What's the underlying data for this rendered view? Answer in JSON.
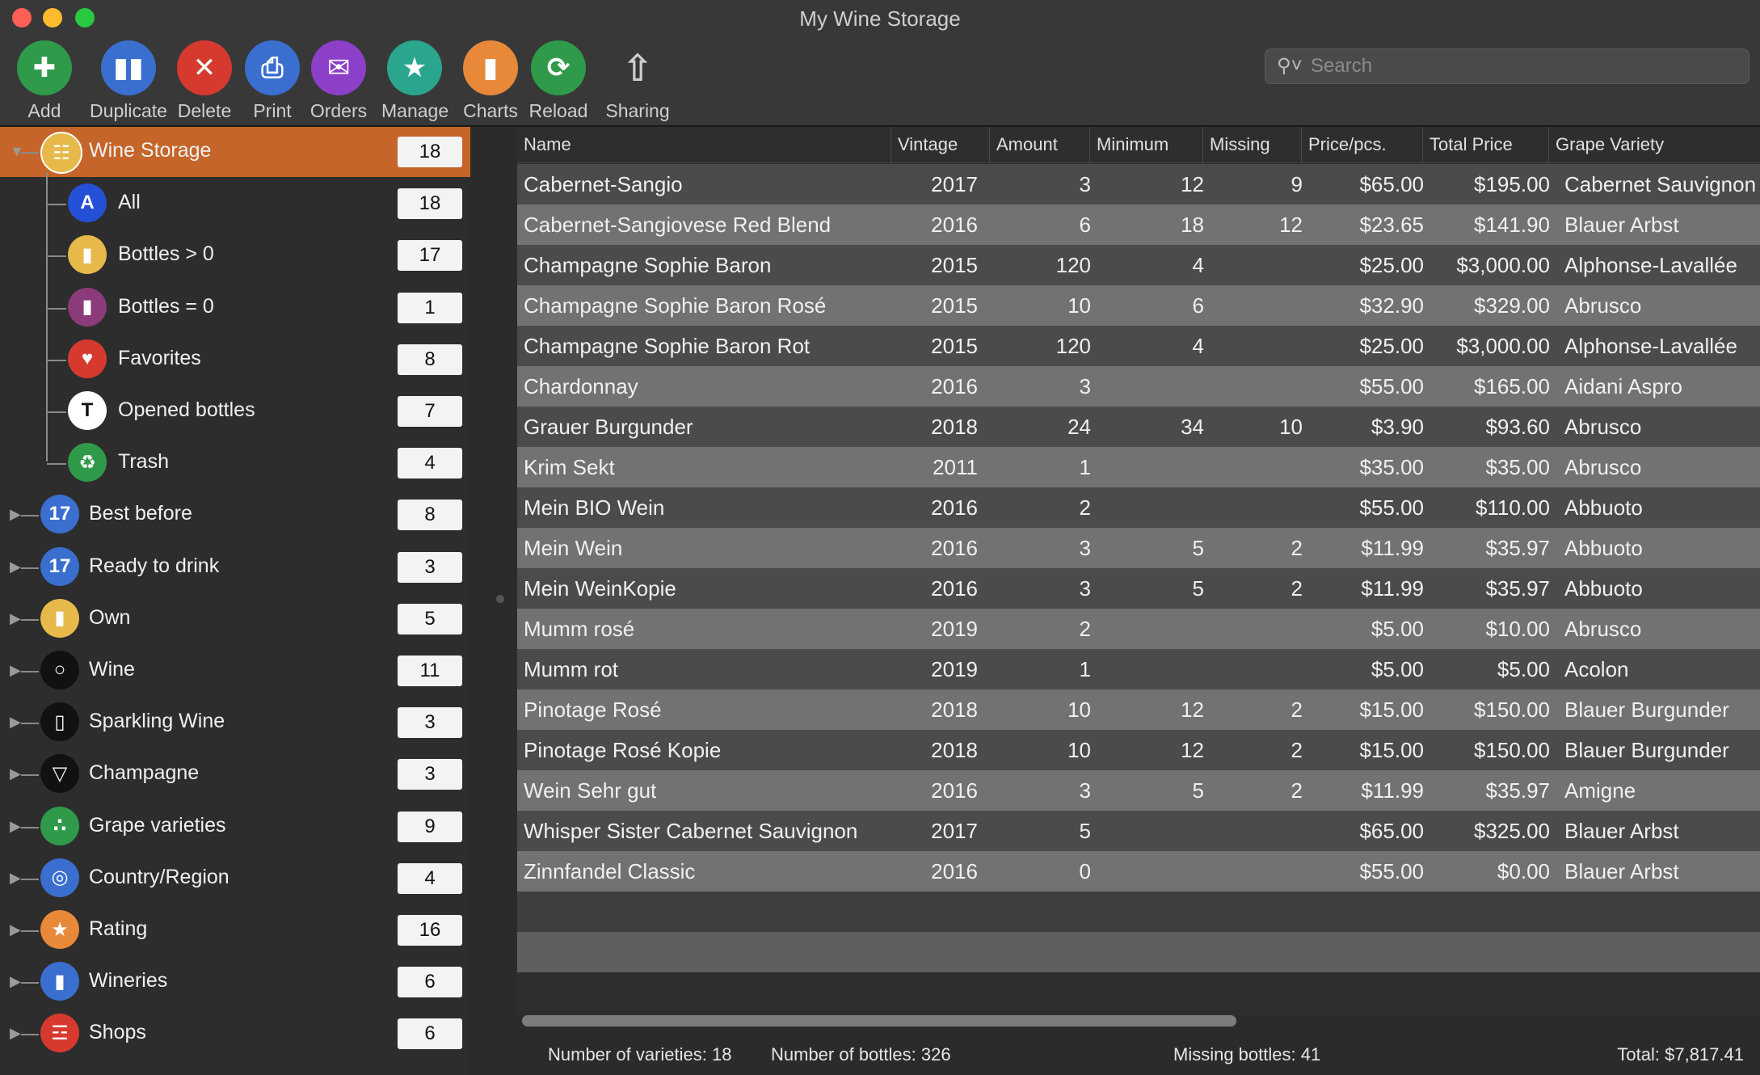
{
  "window": {
    "title": "My Wine Storage"
  },
  "toolbar": {
    "items": [
      {
        "label": "Add",
        "icon": "add-bottle-icon",
        "color": "#2e9a4a"
      },
      {
        "label": "Duplicate",
        "icon": "duplicate-bottles-icon",
        "color": "#3a6fd0"
      },
      {
        "label": "Delete",
        "icon": "delete-bottle-icon",
        "color": "#d63a2f"
      },
      {
        "label": "Print",
        "icon": "printer-icon",
        "color": "#3a6fd0"
      },
      {
        "label": "Orders",
        "icon": "orders-icon",
        "color": "#8c3fc9"
      },
      {
        "label": "Manage",
        "icon": "manage-icon",
        "color": "#2aa58e"
      },
      {
        "label": "Charts",
        "icon": "charts-icon",
        "color": "#e8893a"
      },
      {
        "label": "Reload",
        "icon": "reload-icon",
        "color": "#2e9a4a"
      },
      {
        "label": "Sharing",
        "icon": "share-icon",
        "color": "transparent"
      }
    ]
  },
  "search": {
    "placeholder": "Search",
    "value": ""
  },
  "sidebar": {
    "root": {
      "label": "Wine Storage",
      "count": "18",
      "icon": "wine-storage-icon"
    },
    "children": [
      {
        "label": "All",
        "count": "18",
        "icon": "letter-a-icon",
        "color": "#2450d6"
      },
      {
        "label": "Bottles > 0",
        "count": "17",
        "icon": "bottle-icon",
        "color": "#e7b94a"
      },
      {
        "label": "Bottles = 0",
        "count": "1",
        "icon": "bottle-empty-icon",
        "color": "#8b3a7a"
      },
      {
        "label": "Favorites",
        "count": "8",
        "icon": "heart-icon",
        "color": "#d63a2f"
      },
      {
        "label": "Opened bottles",
        "count": "7",
        "icon": "corkscrew-icon",
        "color": "#ffffff"
      },
      {
        "label": "Trash",
        "count": "4",
        "icon": "trash-icon",
        "color": "#2e9a4a"
      }
    ],
    "groups": [
      {
        "label": "Best before",
        "count": "8",
        "icon": "calendar-icon",
        "color": "#3a6fd0"
      },
      {
        "label": "Ready to drink",
        "count": "3",
        "icon": "calendar-icon",
        "color": "#3a6fd0"
      },
      {
        "label": "Own",
        "count": "5",
        "icon": "bottle-icon",
        "color": "#e7b94a"
      },
      {
        "label": "Wine",
        "count": "11",
        "icon": "wine-glass-icon",
        "color": "#111111"
      },
      {
        "label": "Sparkling Wine",
        "count": "3",
        "icon": "flute-glass-icon",
        "color": "#111111"
      },
      {
        "label": "Champagne",
        "count": "3",
        "icon": "champagne-glass-icon",
        "color": "#111111"
      },
      {
        "label": "Grape varieties",
        "count": "9",
        "icon": "grapes-icon",
        "color": "#2e9a4a"
      },
      {
        "label": "Country/Region",
        "count": "4",
        "icon": "globe-icon",
        "color": "#3a6fd0"
      },
      {
        "label": "Rating",
        "count": "16",
        "icon": "star-icon",
        "color": "#e8893a"
      },
      {
        "label": "Wineries",
        "count": "6",
        "icon": "winery-icon",
        "color": "#3a6fd0"
      },
      {
        "label": "Shops",
        "count": "6",
        "icon": "cart-icon",
        "color": "#d63a2f"
      }
    ]
  },
  "table": {
    "columns": [
      "Name",
      "Vintage",
      "Amount",
      "Minimum",
      "Missing",
      "Price/pcs.",
      "Total Price",
      "Grape Variety"
    ],
    "rows": [
      [
        "Cabernet-Sangio",
        "2017",
        "3",
        "12",
        "9",
        "$65.00",
        "$195.00",
        "Cabernet Sauvignon"
      ],
      [
        "Cabernet-Sangiovese Red Blend",
        "2016",
        "6",
        "18",
        "12",
        "$23.65",
        "$141.90",
        "Blauer Arbst"
      ],
      [
        "Champagne Sophie Baron",
        "2015",
        "120",
        "4",
        "",
        "$25.00",
        "$3,000.00",
        "Alphonse-Lavallée"
      ],
      [
        "Champagne Sophie Baron Rosé",
        "2015",
        "10",
        "6",
        "",
        "$32.90",
        "$329.00",
        "Abrusco"
      ],
      [
        "Champagne Sophie Baron Rot",
        "2015",
        "120",
        "4",
        "",
        "$25.00",
        "$3,000.00",
        "Alphonse-Lavallée"
      ],
      [
        "Chardonnay",
        "2016",
        "3",
        "",
        "",
        "$55.00",
        "$165.00",
        "Aidani Aspro"
      ],
      [
        "Grauer Burgunder",
        "2018",
        "24",
        "34",
        "10",
        "$3.90",
        "$93.60",
        "Abrusco"
      ],
      [
        "Krim Sekt",
        "2011",
        "1",
        "",
        "",
        "$35.00",
        "$35.00",
        "Abrusco"
      ],
      [
        "Mein BIO Wein",
        "2016",
        "2",
        "",
        "",
        "$55.00",
        "$110.00",
        "Abbuoto"
      ],
      [
        "Mein Wein",
        "2016",
        "3",
        "5",
        "2",
        "$11.99",
        "$35.97",
        "Abbuoto"
      ],
      [
        "Mein WeinKopie",
        "2016",
        "3",
        "5",
        "2",
        "$11.99",
        "$35.97",
        "Abbuoto"
      ],
      [
        "Mumm rosé",
        "2019",
        "2",
        "",
        "",
        "$5.00",
        "$10.00",
        "Abrusco"
      ],
      [
        "Mumm rot",
        "2019",
        "1",
        "",
        "",
        "$5.00",
        "$5.00",
        "Acolon"
      ],
      [
        "Pinotage Rosé",
        "2018",
        "10",
        "12",
        "2",
        "$15.00",
        "$150.00",
        "Blauer Burgunder"
      ],
      [
        "Pinotage Rosé Kopie",
        "2018",
        "10",
        "12",
        "2",
        "$15.00",
        "$150.00",
        "Blauer Burgunder"
      ],
      [
        "Wein Sehr gut",
        "2016",
        "3",
        "5",
        "2",
        "$11.99",
        "$35.97",
        "Amigne"
      ],
      [
        "Whisper Sister Cabernet Sauvignon",
        "2017",
        "5",
        "",
        "",
        "$65.00",
        "$325.00",
        "Blauer Arbst"
      ],
      [
        "Zinnfandel Classic",
        "2016",
        "0",
        "",
        "",
        "$55.00",
        "$0.00",
        "Blauer Arbst"
      ]
    ]
  },
  "status": {
    "varieties": "Number of varieties: 18",
    "bottles": "Number of bottles: 326",
    "missing": "Missing bottles: 41",
    "total": "Total: $7,817.41"
  },
  "colors": {
    "selection": "#c6652a",
    "row_dark": "#4b4b4b",
    "row_light": "#727272"
  }
}
